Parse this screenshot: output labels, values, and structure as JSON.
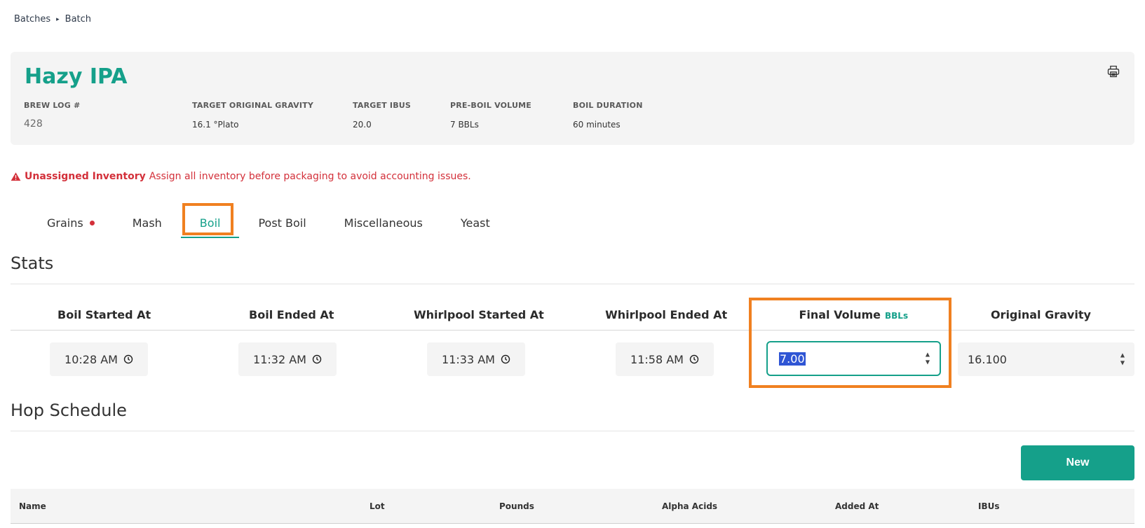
{
  "breadcrumb": {
    "parent": "Batches",
    "current": "Batch",
    "separator": "▸"
  },
  "batch": {
    "title": "Hazy IPA",
    "meta": [
      {
        "label": "BREW LOG #",
        "value": "428"
      },
      {
        "label": "TARGET ORIGINAL GRAVITY",
        "value": "16.1 °Plato"
      },
      {
        "label": "TARGET IBUS",
        "value": "20.0"
      },
      {
        "label": "PRE-BOIL VOLUME",
        "value": "7 BBLs"
      },
      {
        "label": "BOIL DURATION",
        "value": "60 minutes"
      }
    ]
  },
  "warning": {
    "title": "Unassigned Inventory",
    "message": "Assign all inventory before packaging to avoid accounting issues."
  },
  "tabs": [
    {
      "label": "Grains",
      "has_alert": true
    },
    {
      "label": "Mash"
    },
    {
      "label": "Boil",
      "active": true
    },
    {
      "label": "Post Boil"
    },
    {
      "label": "Miscellaneous"
    },
    {
      "label": "Yeast"
    }
  ],
  "stats": {
    "title": "Stats",
    "columns": [
      "Boil Started At",
      "Boil Ended At",
      "Whirlpool Started At",
      "Whirlpool Ended At",
      "Final Volume",
      "Original Gravity"
    ],
    "final_volume_unit": "BBLs",
    "boil_started": "10:28  AM",
    "boil_ended": "11:32  AM",
    "whirlpool_started": "11:33  AM",
    "whirlpool_ended": "11:58  AM",
    "final_volume": "7.00",
    "original_gravity": "16.100"
  },
  "hop_schedule": {
    "title": "Hop Schedule",
    "new_label": "New",
    "columns": [
      "Name",
      "Lot",
      "Pounds",
      "Alpha Acids",
      "Added At",
      "IBUs"
    ]
  },
  "colors": {
    "accent": "#15a08a",
    "alert": "#d3303a",
    "highlight": "#f08020"
  }
}
